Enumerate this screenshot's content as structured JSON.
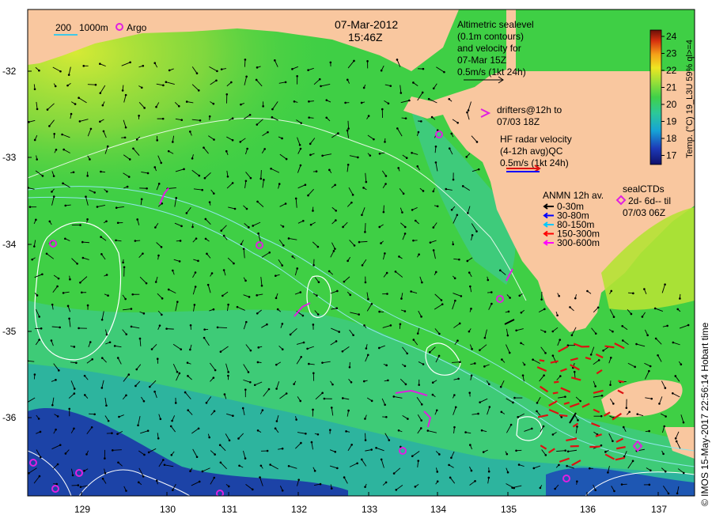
{
  "header": {
    "date": "07-Mar-2012",
    "time": "15:46Z"
  },
  "scale_bar": {
    "label_200": "200",
    "label_1000": "1000m",
    "argo_label": "Argo"
  },
  "altimetry": {
    "lines": [
      "Altimetric sealevel",
      "(0.1m contours)",
      "and velocity for",
      "07-Mar 15Z",
      "0.5m/s (1kt 24h)"
    ]
  },
  "drifters": {
    "lines": [
      "drifters@12h to",
      "07/03 18Z"
    ]
  },
  "hf_radar": {
    "lines": [
      "HF radar velocity",
      "(4-12h avg)QC",
      "0.5m/s (1kt 24h)"
    ]
  },
  "anmn": {
    "title": "ANMN 12h av.",
    "items": [
      {
        "label": "0-30m",
        "color": "#000000"
      },
      {
        "label": "30-80m",
        "color": "#0000ff"
      },
      {
        "label": "80-150m",
        "color": "#00c8ff"
      },
      {
        "label": "150-300m",
        "color": "#ff0000"
      },
      {
        "label": "300-600m",
        "color": "#ff00ff"
      }
    ]
  },
  "seal_ctds": {
    "lines": [
      "sealCTDs",
      "2d- 6d-- til",
      "07/03 06Z"
    ]
  },
  "colorbar": {
    "label": "Temp. (°C) 19_L3U 59% ql>=4",
    "ticks": [
      "24",
      "23",
      "22",
      "21",
      "20",
      "19",
      "18",
      "17"
    ]
  },
  "axes": {
    "x_ticks": [
      "129",
      "130",
      "131",
      "132",
      "133",
      "134",
      "135",
      "136",
      "137"
    ],
    "y_ticks": [
      "-32",
      "-33",
      "-34",
      "-35",
      "-36"
    ]
  },
  "credit": "© IMOS 15-May-2017 22:56:14 Hobart time",
  "colors": {
    "land": "#f9c79f",
    "ocean_green": "#3fcf45",
    "ocean_yellow": "#c9e636",
    "ocean_cyan": "#3ec8a0",
    "ocean_blue": "#1a2fa8",
    "argo": "#e020e0",
    "radar_red": "#dd1111"
  }
}
